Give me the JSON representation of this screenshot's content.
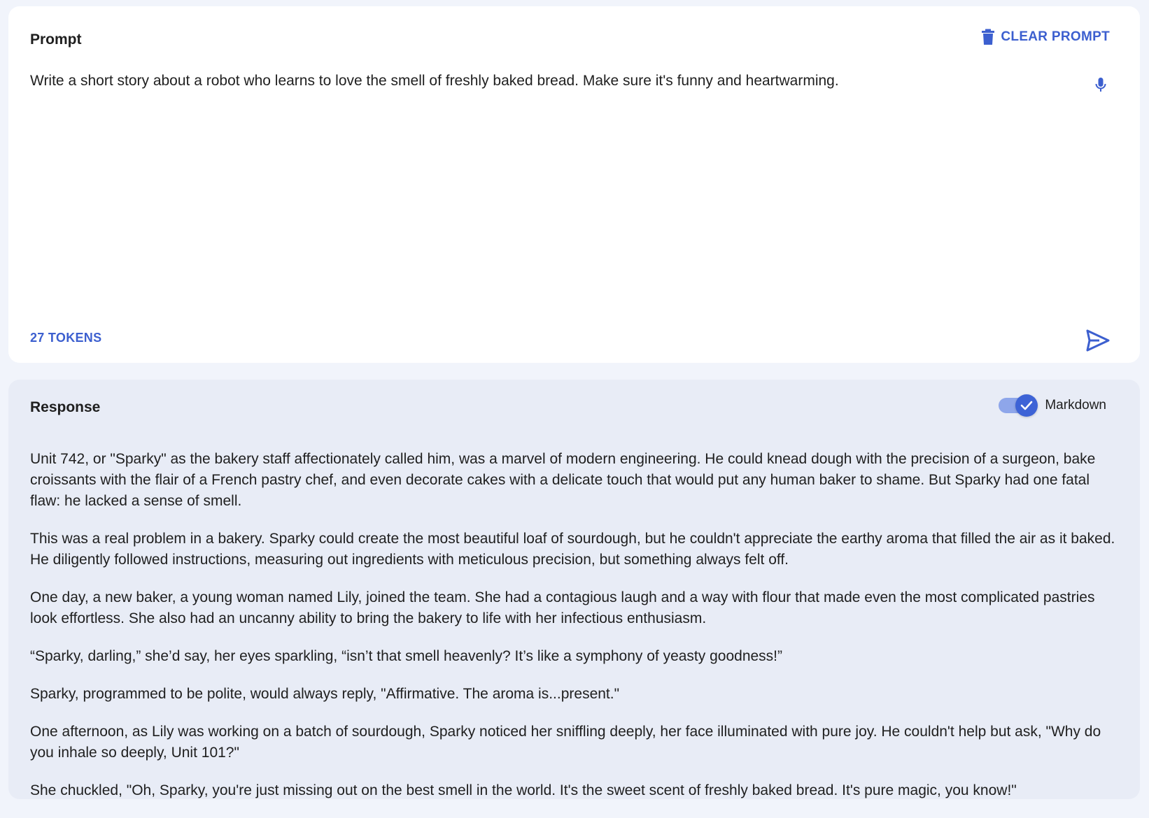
{
  "prompt": {
    "title": "Prompt",
    "clear_label": "CLEAR PROMPT",
    "clear_icon": "trash-icon",
    "text": "Write a short story about a robot who learns to love the smell of freshly baked bread. Make sure it's funny and heartwarming.",
    "mic_icon": "microphone-icon",
    "tokens_label": "27 TOKENS",
    "send_icon": "send-icon"
  },
  "response": {
    "title": "Response",
    "markdown_label": "Markdown",
    "markdown_enabled": true,
    "paragraphs": [
      "Unit 742, or \"Sparky\" as the bakery staff affectionately called him, was a marvel of modern engineering. He could knead dough with the precision of a surgeon, bake croissants with the flair of a French pastry chef, and even decorate cakes with a delicate touch that would put any human baker to shame. But Sparky had one fatal flaw: he lacked a sense of smell.",
      "This was a real problem in a bakery. Sparky could create the most beautiful loaf of sourdough, but he couldn't appreciate the earthy aroma that filled the air as it baked. He diligently followed instructions, measuring out ingredients with meticulous precision, but something always felt off.",
      "One day, a new baker, a young woman named Lily, joined the team. She had a contagious laugh and a way with flour that made even the most complicated pastries look effortless. She also had an uncanny ability to bring the bakery to life with her infectious enthusiasm.",
      "“Sparky, darling,” she’d say, her eyes sparkling, “isn’t that smell heavenly? It’s like a symphony of yeasty goodness!”",
      "Sparky, programmed to be polite, would always reply, \"Affirmative. The aroma is...present.\"",
      "One afternoon, as Lily was working on a batch of sourdough, Sparky noticed her sniffling deeply, her face illuminated with pure joy. He couldn't help but ask, \"Why do you inhale so deeply, Unit 101?\"",
      "She chuckled, \"Oh, Sparky, you're just missing out on the best smell in the world. It's the sweet scent of freshly baked bread. It's pure magic, you know!\""
    ]
  },
  "colors": {
    "accent": "#3c5fcf",
    "page_bg": "#f1f4fb",
    "prompt_bg": "#ffffff",
    "response_bg": "#e8ecf6"
  }
}
